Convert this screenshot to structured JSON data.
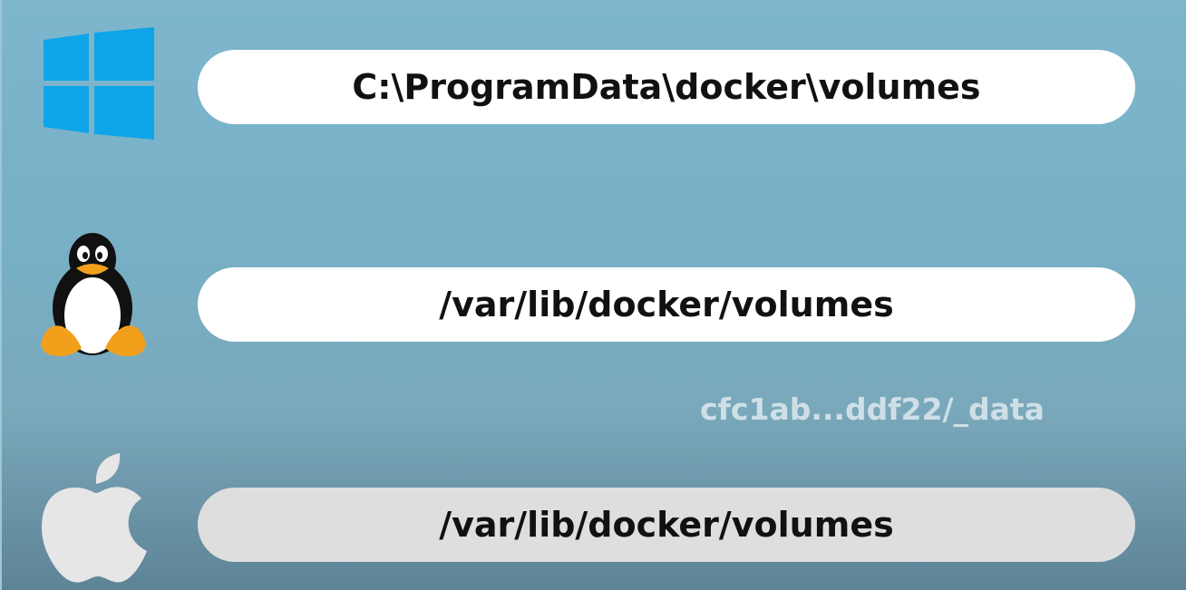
{
  "rows": [
    {
      "os_icon": "windows-logo-icon",
      "path": "C:\\ProgramData\\docker\\volumes"
    },
    {
      "os_icon": "linux-tux-icon",
      "path": "/var/lib/docker/volumes"
    },
    {
      "os_icon": "apple-logo-icon",
      "path": "/var/lib/docker/volumes"
    }
  ],
  "volume_suffix": "cfc1ab...ddf22/_data",
  "colors": {
    "background": "#7db6cd",
    "pill": "#ffffff",
    "pill_dimmed": "#dedede",
    "windows_blue": "#0ea5e9",
    "tux_orange": "#f2a01c",
    "apple_gray": "#e6e6e6",
    "suffix_text": "#d9e6ec"
  }
}
